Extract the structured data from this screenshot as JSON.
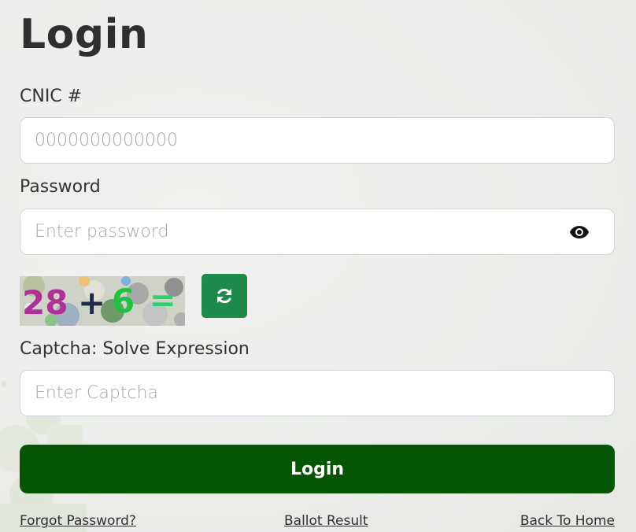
{
  "page": {
    "title": "Login"
  },
  "cnic": {
    "label": "CNIC #",
    "placeholder": "0000000000000",
    "value": ""
  },
  "password": {
    "label": "Password",
    "placeholder": "Enter password",
    "value": "",
    "toggle_icon": "eye-icon"
  },
  "captcha": {
    "expression": [
      "28",
      "+",
      "6",
      "="
    ],
    "refresh_icon": "refresh-icon",
    "label": "Captcha: Solve Expression",
    "placeholder": "Enter Captcha",
    "value": ""
  },
  "login_button": {
    "label": "Login"
  },
  "links": {
    "forgot_password": "Forgot Password?",
    "ballot_result": "Ballot Result",
    "back_to_home": "Back To Home"
  },
  "colors": {
    "primary": "#045504",
    "refresh_button": "#1e8a4c",
    "background": "#eceeea"
  }
}
